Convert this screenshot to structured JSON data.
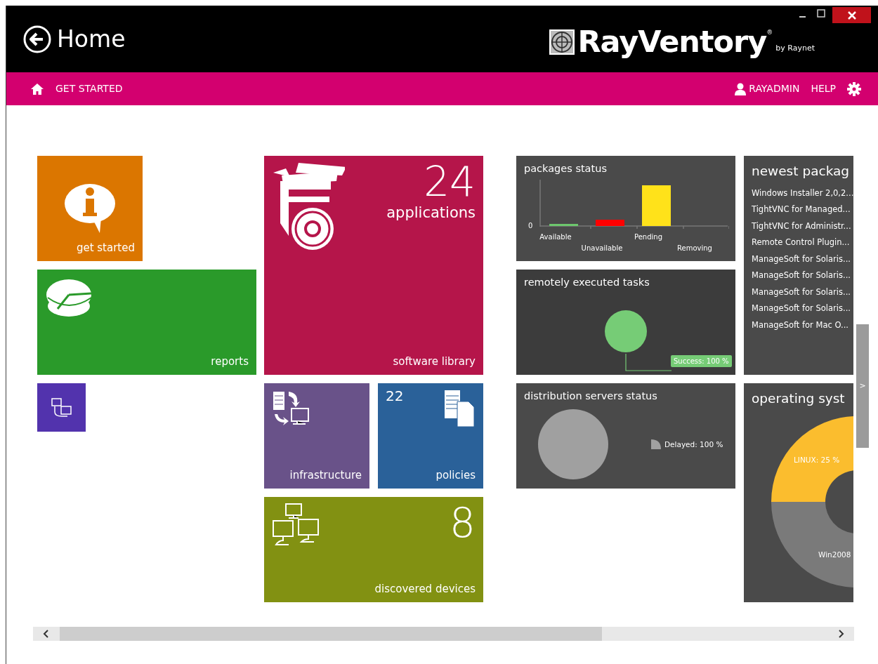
{
  "window": {
    "title": "Home"
  },
  "logo": {
    "name": "RayVentory",
    "mark": "®",
    "byline": "by Raynet"
  },
  "nav": {
    "items": [
      {
        "label": "GET STARTED"
      }
    ],
    "user": "RAYADMIN",
    "help": "HELP"
  },
  "tile_groups": [
    [
      {
        "kind": "info",
        "color": "#db7600",
        "label": "get started"
      },
      {
        "kind": "reports",
        "color": "#2a9a2a",
        "label": "reports"
      },
      {
        "kind": "network",
        "color": "#5233ad"
      }
    ],
    [
      {
        "kind": "library",
        "color": "#b5154a",
        "count": "24",
        "count_label": "applications",
        "label": "software library"
      },
      {
        "kind": "infrastructure",
        "color": "#695289",
        "label": "infrastructure"
      },
      {
        "kind": "policies",
        "color": "#2a6199",
        "count": "22",
        "label": "policies"
      },
      {
        "kind": "devices",
        "color": "#829112",
        "count": "8",
        "label": "discovered devices"
      }
    ],
    [
      {
        "kind": "bar_chart",
        "color": "#4a4a4a",
        "title": "packages status",
        "y_tick": "0",
        "bars": [
          {
            "label": "Available",
            "color": "#6dc76d"
          },
          {
            "label": "Unavailable",
            "color": "#ff0000"
          },
          {
            "label": "Pending",
            "color": "#ffe21a"
          },
          {
            "label": "Removing"
          }
        ]
      },
      {
        "kind": "list",
        "color": "#4a4a4a",
        "title": "newest packag",
        "items": [
          "Windows Installer 2,0,2...",
          "TightVNC for Managed...",
          "TightVNC for Administr...",
          "Remote Control Plugin...",
          "ManageSoft for Solaris...",
          "ManageSoft for Solaris...",
          "ManageSoft for Solaris...",
          "ManageSoft for Solaris...",
          "ManageSoft for Mac O..."
        ]
      },
      {
        "kind": "pie_callout",
        "color": "#3c3c3c",
        "title": "remotely executed tasks",
        "slice": {
          "label": "Success: 100 %",
          "color": "#76cc76"
        }
      },
      {
        "kind": "pie_legend",
        "color": "#4a4a4a",
        "title": "distribution servers status",
        "slice": {
          "label": "Delayed: 100 %",
          "color": "#a0a0a0"
        }
      },
      {
        "kind": "donut",
        "color": "#4a4a4a",
        "title": "operating syst",
        "slices": [
          {
            "label": "LINUX: 25 %",
            "color": "#fbbd2e"
          },
          {
            "label": "Win2008",
            "color": "#7a7a7a"
          }
        ]
      }
    ]
  ],
  "side_handle": {
    "label": ">"
  }
}
